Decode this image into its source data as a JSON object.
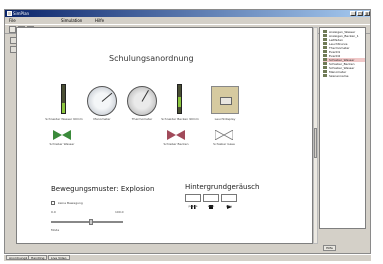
{
  "window": {
    "title": "SimPlan",
    "controls": {
      "minimize": "_",
      "maximize": "□",
      "close": "x"
    }
  },
  "menu": [
    "File",
    "Simulation",
    "Hilfe"
  ],
  "toolbar_icons": [
    "new-icon",
    "save-icon",
    "open-icon"
  ],
  "canvas": {
    "title": "Schulungsanordnung",
    "components": [
      {
        "label": "Schneider Wasser 90mm"
      },
      {
        "label": "Manometer"
      },
      {
        "label": "Thermometer"
      },
      {
        "label": "Schneider Becken 90mm"
      },
      {
        "label": "Leuchtdisplay"
      },
      {
        "label": "Schieber Wasser"
      },
      {
        "label": "Schieber Becken"
      },
      {
        "label": "Schieber Gase"
      }
    ],
    "movement": {
      "title": "Bewegungsmuster: Explosion",
      "checkbox_label": "keine Bewegung",
      "min": "0.0",
      "max": "100.0",
      "caption": "Mode"
    },
    "noise": {
      "title": "Hintergrundgeräusch",
      "buttons": [
        "pause",
        "stop",
        "play"
      ],
      "icons": [
        "pause-icon",
        "stop-icon",
        "play-icon"
      ]
    }
  },
  "sidebar": {
    "tree": [
      {
        "label": "Anzeigen_Wasser"
      },
      {
        "label": "Anzeigen_Becken_1"
      },
      {
        "label": "Leitfaden"
      },
      {
        "label": "Leuchtkurve"
      },
      {
        "label": "Thermometer"
      },
      {
        "label": "Eventl1"
      },
      {
        "label": "Eventl2"
      },
      {
        "label": "Schieber_Wasser",
        "selected": true
      },
      {
        "label": "Schieber_Becken"
      },
      {
        "label": "Schieber_Wasser"
      },
      {
        "label": "Manometer"
      },
      {
        "label": "Szenenname"
      }
    ],
    "button": "Hilfe"
  },
  "status_tabs": [
    "Anordnung1",
    "Handling",
    "Live Video"
  ]
}
